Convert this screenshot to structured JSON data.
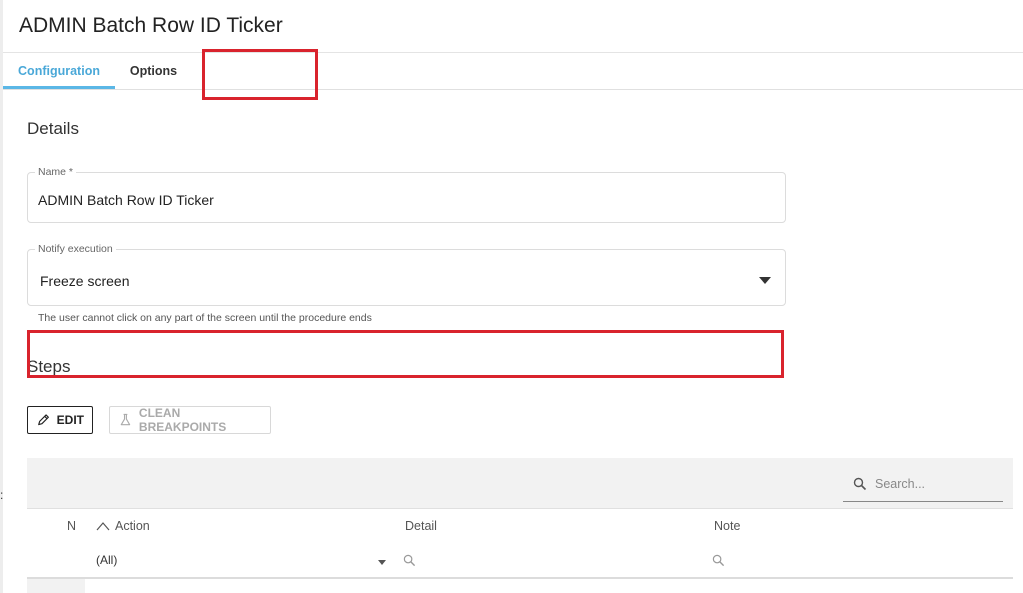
{
  "page": {
    "title": "ADMIN Batch Row ID Ticker"
  },
  "tabs": [
    {
      "label": "Configuration",
      "active": true
    },
    {
      "label": "Options",
      "active": false
    }
  ],
  "details": {
    "title": "Details",
    "name_field": {
      "label": "Name *",
      "value": "ADMIN Batch Row ID Ticker"
    },
    "notify_field": {
      "label": "Notify execution",
      "value": "Freeze screen",
      "hint": "The user cannot click on any part of the screen until the procedure ends"
    }
  },
  "steps": {
    "title": "Steps",
    "edit_label": "EDIT",
    "clean_label": "CLEAN BREAKPOINTS",
    "search_placeholder": "Search...",
    "columns": {
      "n": "N",
      "action": "Action",
      "detail": "Detail",
      "note": "Note"
    },
    "filter": {
      "action_value": "(All)"
    }
  },
  "icons": {
    "edit": "pencil-icon",
    "clean": "flask-icon",
    "search": "search-icon",
    "sort": "sort-up-icon"
  },
  "colors": {
    "accent": "#5bb7e6",
    "highlight": "#d9232d"
  }
}
